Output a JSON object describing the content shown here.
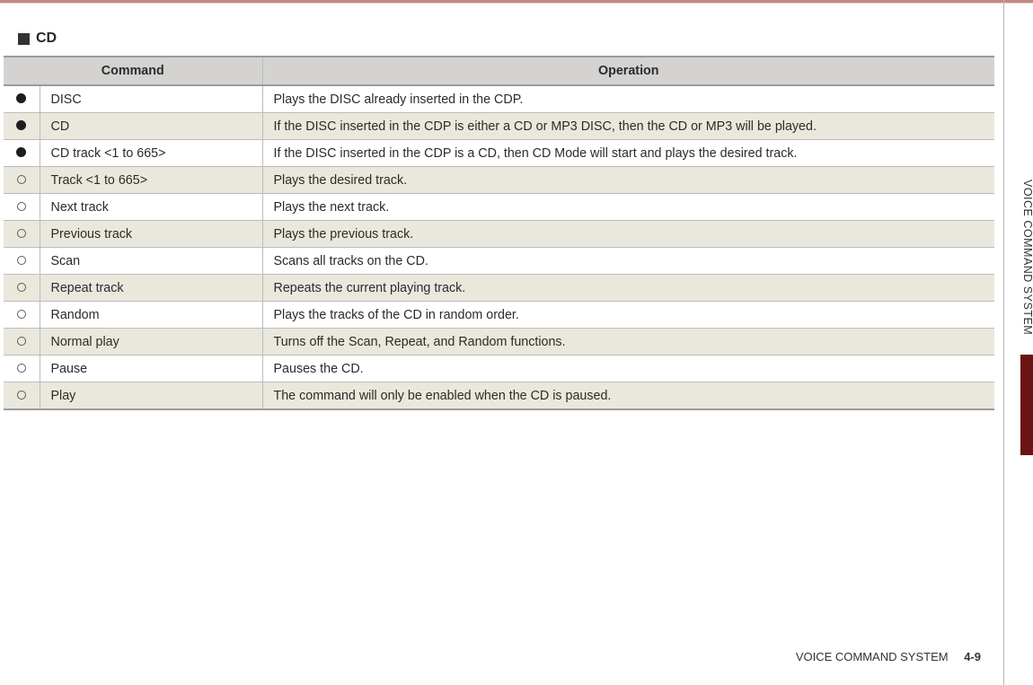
{
  "section": {
    "title": "CD"
  },
  "table": {
    "headers": {
      "command": "Command",
      "operation": "Operation"
    },
    "rows": [
      {
        "icon": "filled",
        "command": "DISC",
        "operation": "Plays the DISC already inserted in the CDP.",
        "alt": false
      },
      {
        "icon": "filled",
        "command": "CD",
        "operation": "If the DISC inserted in the CDP is either a CD or MP3 DISC, then the CD or MP3 will be played.",
        "alt": true
      },
      {
        "icon": "filled",
        "command": "CD track <1 to 665>",
        "operation": "If the DISC inserted in the CDP is a CD, then CD Mode will start and plays the desired track.",
        "alt": false
      },
      {
        "icon": "empty",
        "command": "Track <1 to 665>",
        "operation": "Plays the desired track.",
        "alt": true
      },
      {
        "icon": "empty",
        "command": "Next track",
        "operation": "Plays the next track.",
        "alt": false
      },
      {
        "icon": "empty",
        "command": "Previous track",
        "operation": "Plays the previous track.",
        "alt": true
      },
      {
        "icon": "empty",
        "command": "Scan",
        "operation": "Scans all tracks on the CD.",
        "alt": false
      },
      {
        "icon": "empty",
        "command": "Repeat track",
        "operation": "Repeats the current playing track.",
        "alt": true
      },
      {
        "icon": "empty",
        "command": "Random",
        "operation": "Plays the tracks of the CD in random order.",
        "alt": false
      },
      {
        "icon": "empty",
        "command": "Normal play",
        "operation": "Turns off the Scan, Repeat, and Random functions.",
        "alt": true
      },
      {
        "icon": "empty",
        "command": "Pause",
        "operation": "Pauses the CD.",
        "alt": false
      },
      {
        "icon": "empty",
        "command": "Play",
        "operation": "The command will only be enabled when the CD is paused.",
        "alt": true
      }
    ]
  },
  "sidebar": {
    "label": "VOICE COMMAND SYSTEM"
  },
  "footer": {
    "section": "VOICE COMMAND SYSTEM",
    "page": "4-9"
  }
}
